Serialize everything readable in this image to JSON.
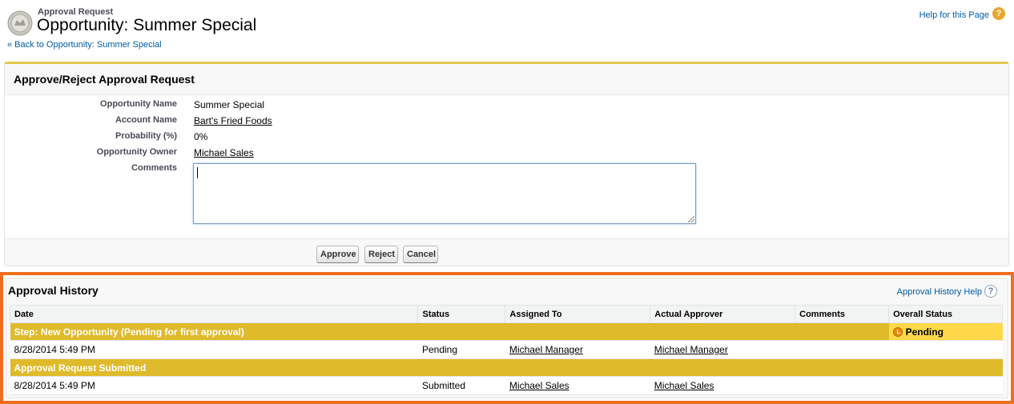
{
  "header": {
    "subtitle": "Approval Request",
    "title": "Opportunity: Summer Special",
    "back_link": "« Back to Opportunity: Summer Special",
    "help_link": "Help for this Page",
    "help_icon": "?"
  },
  "panel": {
    "title": "Approve/Reject Approval Request",
    "fields": [
      {
        "label": "Opportunity Name",
        "value": "Summer Special",
        "link": false
      },
      {
        "label": "Account Name",
        "value": "Bart's Fried Foods",
        "link": true
      },
      {
        "label": "Probability (%)",
        "value": "0%",
        "link": false
      },
      {
        "label": "Opportunity Owner",
        "value": "Michael Sales",
        "link": true
      },
      {
        "label": "Comments",
        "value": "",
        "link": false
      }
    ],
    "comments_value": "",
    "buttons": {
      "approve": "Approve",
      "reject": "Reject",
      "cancel": "Cancel"
    }
  },
  "history": {
    "title": "Approval History",
    "help_link": "Approval History Help",
    "help_icon": "?",
    "columns": [
      "Date",
      "Status",
      "Assigned To",
      "Actual Approver",
      "Comments",
      "Overall Status"
    ],
    "step1": {
      "label": "Step: New Opportunity (Pending for first approval)",
      "overall_status": "Pending"
    },
    "row1": {
      "date": "8/28/2014 5:49 PM",
      "status": "Pending",
      "assigned_to": "Michael Manager",
      "actual_approver": "Michael Manager",
      "comments": ""
    },
    "step2": {
      "label": "Approval Request Submitted"
    },
    "row2": {
      "date": "8/28/2014 5:49 PM",
      "status": "Submitted",
      "assigned_to": "Michael Sales",
      "actual_approver": "Michael Sales",
      "comments": ""
    }
  },
  "colors": {
    "accent_orange": "#f06e1e",
    "step_gold": "#dfba2b",
    "pending_yellow": "#ffd84a",
    "link_blue": "#015ba7"
  }
}
